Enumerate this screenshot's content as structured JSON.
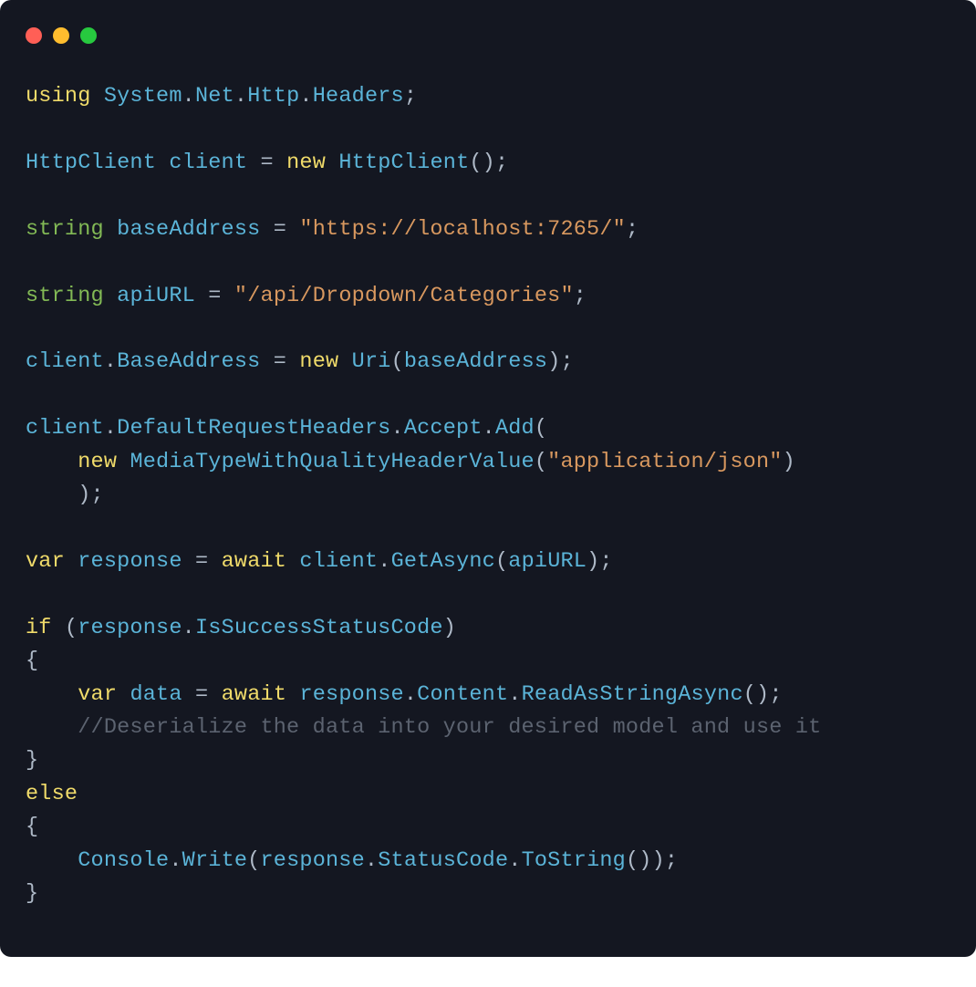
{
  "titlebar": {
    "buttons": [
      "close",
      "minimize",
      "zoom"
    ]
  },
  "code": {
    "language": "csharp",
    "tokens": [
      [
        {
          "c": "kw",
          "t": "using"
        },
        {
          "c": "punct",
          "t": " "
        },
        {
          "c": "type",
          "t": "System"
        },
        {
          "c": "punct",
          "t": "."
        },
        {
          "c": "type",
          "t": "Net"
        },
        {
          "c": "punct",
          "t": "."
        },
        {
          "c": "type",
          "t": "Http"
        },
        {
          "c": "punct",
          "t": "."
        },
        {
          "c": "type",
          "t": "Headers"
        },
        {
          "c": "punct",
          "t": ";"
        }
      ],
      [],
      [
        {
          "c": "type",
          "t": "HttpClient"
        },
        {
          "c": "punct",
          "t": " "
        },
        {
          "c": "ident",
          "t": "client"
        },
        {
          "c": "punct",
          "t": " "
        },
        {
          "c": "op",
          "t": "="
        },
        {
          "c": "punct",
          "t": " "
        },
        {
          "c": "kw",
          "t": "new"
        },
        {
          "c": "punct",
          "t": " "
        },
        {
          "c": "type",
          "t": "HttpClient"
        },
        {
          "c": "punct",
          "t": "();"
        }
      ],
      [],
      [
        {
          "c": "builtin",
          "t": "string"
        },
        {
          "c": "punct",
          "t": " "
        },
        {
          "c": "ident",
          "t": "baseAddress"
        },
        {
          "c": "punct",
          "t": " "
        },
        {
          "c": "op",
          "t": "="
        },
        {
          "c": "punct",
          "t": " "
        },
        {
          "c": "str",
          "t": "\"https://localhost:7265/\""
        },
        {
          "c": "punct",
          "t": ";"
        }
      ],
      [],
      [
        {
          "c": "builtin",
          "t": "string"
        },
        {
          "c": "punct",
          "t": " "
        },
        {
          "c": "ident",
          "t": "apiURL"
        },
        {
          "c": "punct",
          "t": " "
        },
        {
          "c": "op",
          "t": "="
        },
        {
          "c": "punct",
          "t": " "
        },
        {
          "c": "str",
          "t": "\"/api/Dropdown/Categories\""
        },
        {
          "c": "punct",
          "t": ";"
        }
      ],
      [],
      [
        {
          "c": "ident",
          "t": "client"
        },
        {
          "c": "punct",
          "t": "."
        },
        {
          "c": "ident",
          "t": "BaseAddress"
        },
        {
          "c": "punct",
          "t": " "
        },
        {
          "c": "op",
          "t": "="
        },
        {
          "c": "punct",
          "t": " "
        },
        {
          "c": "kw",
          "t": "new"
        },
        {
          "c": "punct",
          "t": " "
        },
        {
          "c": "type",
          "t": "Uri"
        },
        {
          "c": "punct",
          "t": "("
        },
        {
          "c": "ident",
          "t": "baseAddress"
        },
        {
          "c": "punct",
          "t": ");"
        }
      ],
      [],
      [
        {
          "c": "ident",
          "t": "client"
        },
        {
          "c": "punct",
          "t": "."
        },
        {
          "c": "ident",
          "t": "DefaultRequestHeaders"
        },
        {
          "c": "punct",
          "t": "."
        },
        {
          "c": "ident",
          "t": "Accept"
        },
        {
          "c": "punct",
          "t": "."
        },
        {
          "c": "method",
          "t": "Add"
        },
        {
          "c": "punct",
          "t": "("
        }
      ],
      [
        {
          "c": "punct",
          "t": "    "
        },
        {
          "c": "kw",
          "t": "new"
        },
        {
          "c": "punct",
          "t": " "
        },
        {
          "c": "type",
          "t": "MediaTypeWithQualityHeaderValue"
        },
        {
          "c": "punct",
          "t": "("
        },
        {
          "c": "str",
          "t": "\"application/json\""
        },
        {
          "c": "punct",
          "t": ")"
        }
      ],
      [
        {
          "c": "punct",
          "t": "    );"
        }
      ],
      [],
      [
        {
          "c": "kw",
          "t": "var"
        },
        {
          "c": "punct",
          "t": " "
        },
        {
          "c": "ident",
          "t": "response"
        },
        {
          "c": "punct",
          "t": " "
        },
        {
          "c": "op",
          "t": "="
        },
        {
          "c": "punct",
          "t": " "
        },
        {
          "c": "kw",
          "t": "await"
        },
        {
          "c": "punct",
          "t": " "
        },
        {
          "c": "ident",
          "t": "client"
        },
        {
          "c": "punct",
          "t": "."
        },
        {
          "c": "method",
          "t": "GetAsync"
        },
        {
          "c": "punct",
          "t": "("
        },
        {
          "c": "ident",
          "t": "apiURL"
        },
        {
          "c": "punct",
          "t": ");"
        }
      ],
      [],
      [
        {
          "c": "kw",
          "t": "if"
        },
        {
          "c": "punct",
          "t": " ("
        },
        {
          "c": "ident",
          "t": "response"
        },
        {
          "c": "punct",
          "t": "."
        },
        {
          "c": "ident",
          "t": "IsSuccessStatusCode"
        },
        {
          "c": "punct",
          "t": ")"
        }
      ],
      [
        {
          "c": "punct",
          "t": "{"
        }
      ],
      [
        {
          "c": "punct",
          "t": "    "
        },
        {
          "c": "kw",
          "t": "var"
        },
        {
          "c": "punct",
          "t": " "
        },
        {
          "c": "ident",
          "t": "data"
        },
        {
          "c": "punct",
          "t": " "
        },
        {
          "c": "op",
          "t": "="
        },
        {
          "c": "punct",
          "t": " "
        },
        {
          "c": "kw",
          "t": "await"
        },
        {
          "c": "punct",
          "t": " "
        },
        {
          "c": "ident",
          "t": "response"
        },
        {
          "c": "punct",
          "t": "."
        },
        {
          "c": "ident",
          "t": "Content"
        },
        {
          "c": "punct",
          "t": "."
        },
        {
          "c": "method",
          "t": "ReadAsStringAsync"
        },
        {
          "c": "punct",
          "t": "();"
        }
      ],
      [
        {
          "c": "punct",
          "t": "    "
        },
        {
          "c": "comment",
          "t": "//Deserialize the data into your desired model and use it"
        }
      ],
      [
        {
          "c": "punct",
          "t": "}"
        }
      ],
      [
        {
          "c": "kw",
          "t": "else"
        }
      ],
      [
        {
          "c": "punct",
          "t": "{"
        }
      ],
      [
        {
          "c": "punct",
          "t": "    "
        },
        {
          "c": "type",
          "t": "Console"
        },
        {
          "c": "punct",
          "t": "."
        },
        {
          "c": "method",
          "t": "Write"
        },
        {
          "c": "punct",
          "t": "("
        },
        {
          "c": "ident",
          "t": "response"
        },
        {
          "c": "punct",
          "t": "."
        },
        {
          "c": "ident",
          "t": "StatusCode"
        },
        {
          "c": "punct",
          "t": "."
        },
        {
          "c": "method",
          "t": "ToString"
        },
        {
          "c": "punct",
          "t": "());"
        }
      ],
      [
        {
          "c": "punct",
          "t": "}"
        }
      ]
    ]
  }
}
